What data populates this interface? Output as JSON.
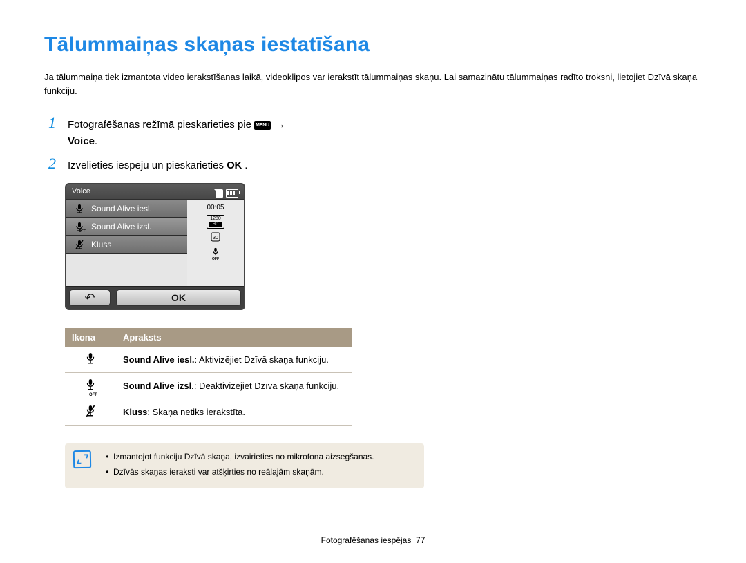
{
  "title": "Tālummaiņas skaņas iestatīšana",
  "intro": "Ja tālummaiņa tiek izmantota video ierakstīšanas laikā, videoklipos var ierakstīt tālummaiņas skaņu. Lai samazinātu tālummaiņas radīto troksni, lietojiet Dzīvā skaņa funkciju.",
  "steps": {
    "s1_pre": "Fotografēšanas režīmā pieskarieties pie ",
    "s1_arrow": "→",
    "s1_bold": "Voice",
    "menu": "MENU",
    "s2": "Izvēlieties iespēju un pieskarieties ",
    "ok_glyph": "OK"
  },
  "camera": {
    "header": "Voice",
    "items": [
      "Sound Alive iesl.",
      "Sound Alive izsl.",
      "Kluss"
    ],
    "time": "00:05",
    "res_top": "1280",
    "res_hd": "HD",
    "fps": "30",
    "off": "OFF",
    "back": "↶",
    "ok": "OK"
  },
  "table": {
    "col1": "Ikona",
    "col2": "Apraksts",
    "rows": [
      {
        "bold": "Sound Alive iesl.",
        "rest": ": Aktivizējiet Dzīvā skaņa funkciju."
      },
      {
        "bold": "Sound Alive izsl.",
        "rest": ": Deaktivizējiet Dzīvā skaņa funkciju."
      },
      {
        "bold": "Kluss",
        "rest": ": Skaņa netiks ierakstīta."
      }
    ]
  },
  "note": {
    "bullets": [
      "Izmantojot funkciju Dzīvā skaņa, izvairieties no mikrofona aizsegšanas.",
      "Dzīvās skaņas ieraksti var atšķirties no reālajām skaņām."
    ]
  },
  "footer": {
    "section": "Fotografēšanas iespējas",
    "page": "77"
  }
}
